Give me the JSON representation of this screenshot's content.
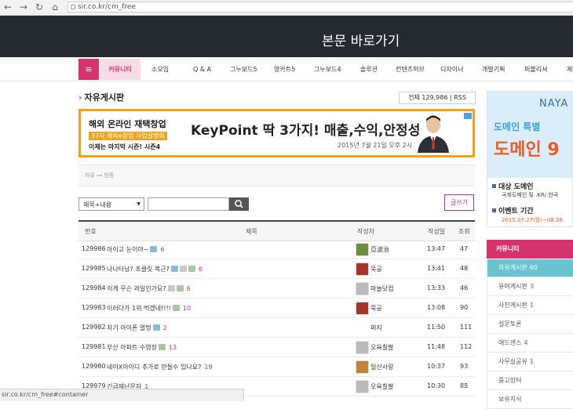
{
  "browser": {
    "url": "sir.co.kr/cm_free"
  },
  "header": {
    "skip_link": "본문 바로가기"
  },
  "nav": {
    "menu_icon": "≡",
    "active": "커뮤니티",
    "items": [
      "소모임",
      "Q & A",
      "그누보드5",
      "영카트5",
      "그누보드4",
      "솔루션",
      "컨텐츠허브",
      "디자이너",
      "개발기획",
      "퍼블리셔",
      "제"
    ]
  },
  "board": {
    "title": "자유게시판",
    "count_label": "전체 129,986",
    "rss_label": "RSS",
    "category_text": "자유 ⊶ 방증"
  },
  "banner": {
    "line1": "해외 온라인 재택창업",
    "line2": "37차 해외e창업 사업설명회",
    "line3": "이제는 마지막 시즌! 시즌4",
    "headline": "KeyPoint 딱 3가지! 매출,수익,안정성",
    "date": "2015년 7월 21일 오후 2시"
  },
  "search": {
    "select_value": "제목+내용",
    "input_value": "",
    "write_label": "글쓰기"
  },
  "table": {
    "headers": [
      "번호",
      "제목",
      "작성자",
      "작성일",
      "조회"
    ],
    "rows": [
      {
        "num": "129986",
        "subject": "아이고 눈이야~",
        "icons": [
          "blue"
        ],
        "comments": "6",
        "author": "亞波治",
        "time": "13:47",
        "hits": "47",
        "avatar": "#6a8f3a"
      },
      {
        "num": "129985",
        "subject": "나나타남? 초클릿 복근?",
        "icons": [
          "blue",
          "att",
          "img"
        ],
        "comments": "6",
        "author": "묵공",
        "time": "13:41",
        "hits": "48",
        "avatar": "#a8332a"
      },
      {
        "num": "129984",
        "subject": "이게 무슨 과일인가요?",
        "icons": [
          "att",
          "img"
        ],
        "comments": "6",
        "author": "마놀닷컴",
        "time": "13:33",
        "hits": "46",
        "avatar": "#bbbbbb"
      },
      {
        "num": "129983",
        "subject": "이러다가 1위 먹겠네!!!!",
        "icons": [
          "img"
        ],
        "comments": "10",
        "author": "묵공",
        "time": "13:08",
        "hits": "90",
        "avatar": "#a8332a"
      },
      {
        "num": "129982",
        "subject": "차기 아이폰 열멍",
        "icons": [
          "blue"
        ],
        "comments": "2",
        "author": "퍼지",
        "time": "11:50",
        "hits": "111",
        "avatar": "#ffffff"
      },
      {
        "num": "129981",
        "subject": "부산 아파트 수영장",
        "icons": [
          "img"
        ],
        "comments": "13",
        "author": "오육칠팔",
        "time": "11:48",
        "hits": "112",
        "avatar": "#bbbbbb"
      },
      {
        "num": "129980",
        "subject": "네이X아이디 추가로 만들수 있나요?",
        "icons": [],
        "comments": "19",
        "author": "일산사랑",
        "time": "10:37",
        "hits": "93",
        "avatar": "#c4823a"
      },
      {
        "num": "129979",
        "subject": "긴급재난문자",
        "icons": [],
        "comments": "1",
        "author": "오육칠팔",
        "time": "10:30",
        "hits": "85",
        "avatar": "#bbbbbb"
      }
    ]
  },
  "status_bar": {
    "text": "sir.co.kr/cm_free#container"
  },
  "ad": {
    "logo": "NAYA",
    "line1": "도메인 특별",
    "line2": "도메인 9",
    "line3": "대상 도메인",
    "line4": "국제도메인 및 .KR/.한국",
    "line5": "이벤트 기간",
    "line6": "2015.07.27(월)~08.26"
  },
  "community": {
    "title": "커뮤니티",
    "items": [
      {
        "label": "자유게시판",
        "count": "60"
      },
      {
        "label": "유머게시판",
        "count": "3"
      },
      {
        "label": "사진게시판",
        "count": "1"
      },
      {
        "label": "설문토론",
        "count": ""
      },
      {
        "label": "애드센스",
        "count": "4"
      },
      {
        "label": "사무실공유",
        "count": "1"
      },
      {
        "label": "중고장터",
        "count": ""
      },
      {
        "label": "보유지식",
        "count": ""
      }
    ]
  }
}
